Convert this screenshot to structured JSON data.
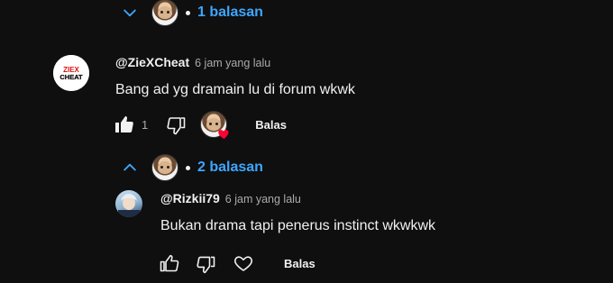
{
  "top_thread": {
    "replies_toggle": {
      "label": "1 balasan",
      "state": "collapsed"
    }
  },
  "comment": {
    "author": "@ZieXCheat",
    "time": "6 jam yang lalu",
    "text": "Bang ad yg dramain lu di forum wkwk",
    "like_count": "1",
    "reply_label": "Balas",
    "avatar_logo": "ZIEX CHEAT",
    "creator_heart": true,
    "replies_toggle": {
      "label": "2 balasan",
      "state": "expanded"
    }
  },
  "reply": {
    "author": "@Rizkii79",
    "time": "6 jam yang lalu",
    "text": "Bukan drama tapi penerus instinct wkwkwk",
    "reply_label": "Balas"
  },
  "icons": {
    "chevron_down": "chevron-down-icon",
    "chevron_up": "chevron-up-icon",
    "like": "thumb-up-icon",
    "dislike": "thumb-down-icon",
    "heart": "heart-icon"
  },
  "colors": {
    "background": "#0f0f0f",
    "link_blue": "#3ea6ff",
    "heart_red": "#ff0033",
    "secondary_text": "#aaaaaa"
  }
}
